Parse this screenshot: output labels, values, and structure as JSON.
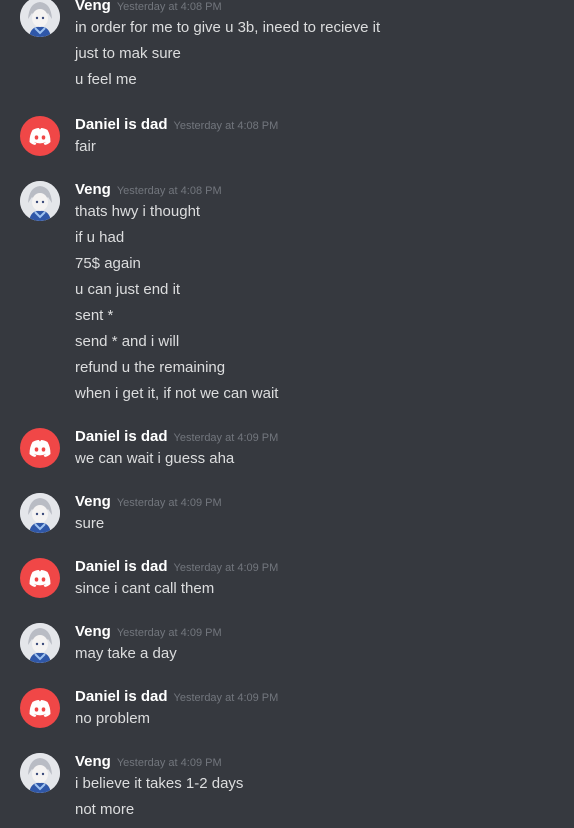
{
  "colors": {
    "background": "#36393f",
    "username": "#ffffff",
    "message_text": "#dcddde",
    "timestamp": "#72767d",
    "dad_avatar_bg": "#f04747"
  },
  "messages": [
    {
      "author": "Veng",
      "timestamp": "Yesterday at 4:08 PM",
      "avatar": "anime-character-avatar",
      "lines": [
        "in order for me to give u 3b, ineed to recieve it",
        "just to mak sure",
        "u feel me"
      ]
    },
    {
      "author": "Daniel is dad",
      "timestamp": "Yesterday at 4:08 PM",
      "avatar": "discord-logo-avatar",
      "lines": [
        "fair"
      ]
    },
    {
      "author": "Veng",
      "timestamp": "Yesterday at 4:08 PM",
      "avatar": "anime-character-avatar",
      "lines": [
        "thats hwy i thought",
        "if u had",
        "75$ again",
        "u can just end it",
        "sent *",
        "send * and i will",
        "refund u the remaining",
        "when i get it, if not we can wait"
      ]
    },
    {
      "author": "Daniel is dad",
      "timestamp": "Yesterday at 4:09 PM",
      "avatar": "discord-logo-avatar",
      "lines": [
        "we can wait i guess aha"
      ]
    },
    {
      "author": "Veng",
      "timestamp": "Yesterday at 4:09 PM",
      "avatar": "anime-character-avatar",
      "lines": [
        "sure"
      ]
    },
    {
      "author": "Daniel is dad",
      "timestamp": "Yesterday at 4:09 PM",
      "avatar": "discord-logo-avatar",
      "lines": [
        "since i cant call them"
      ]
    },
    {
      "author": "Veng",
      "timestamp": "Yesterday at 4:09 PM",
      "avatar": "anime-character-avatar",
      "lines": [
        "may take a day"
      ]
    },
    {
      "author": "Daniel is dad",
      "timestamp": "Yesterday at 4:09 PM",
      "avatar": "discord-logo-avatar",
      "lines": [
        "no problem"
      ]
    },
    {
      "author": "Veng",
      "timestamp": "Yesterday at 4:09 PM",
      "avatar": "anime-character-avatar",
      "lines": [
        "i believe it takes 1-2 days",
        "not more"
      ]
    }
  ]
}
